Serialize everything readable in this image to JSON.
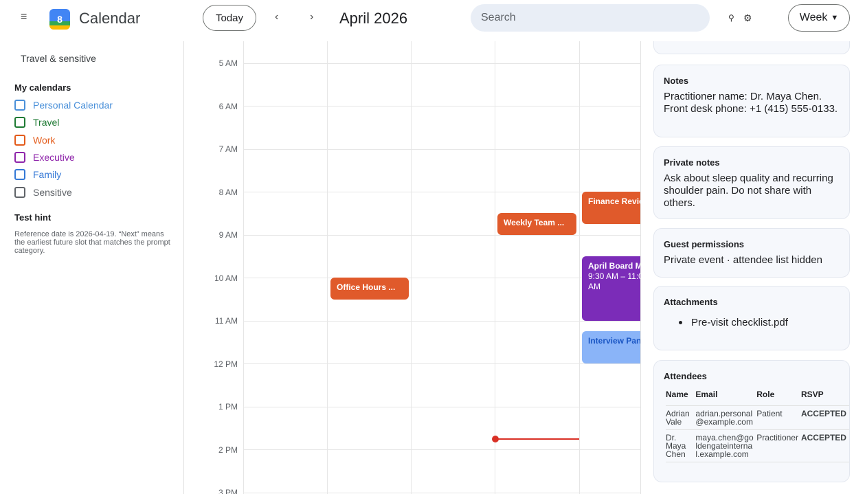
{
  "header": {
    "menu_icon": "menu-icon",
    "app_logo_number": "8",
    "app_title": "Calendar",
    "today_label": "Today",
    "prev_glyph": "‹",
    "next_glyph": "›",
    "month_label": "April 2026",
    "search_placeholder": "Search",
    "view_label": "Week"
  },
  "sidebar": {
    "group_label": "Travel & sensitive",
    "my_calendars_title": "My calendars",
    "calendars": [
      {
        "label": "Personal Calendar",
        "color": "#4a90d9"
      },
      {
        "label": "Travel",
        "color": "#1e7a33"
      },
      {
        "label": "Work",
        "color": "#e35b1a"
      },
      {
        "label": "Executive",
        "color": "#8e24aa"
      },
      {
        "label": "Family",
        "color": "#3478d6"
      },
      {
        "label": "Sensitive",
        "color": "#5f6368"
      }
    ],
    "hint_title": "Test hint",
    "hint_text": "Reference date is 2026-04-19. “Next” means the earliest future slot that matches the prompt category."
  },
  "grid": {
    "time_labels": [
      "5 AM",
      "6 AM",
      "7 AM",
      "8 AM",
      "9 AM",
      "10 AM",
      "11 AM",
      "12 PM",
      "1 PM",
      "2 PM",
      "3 PM"
    ],
    "events": [
      {
        "title": "Finance Revie",
        "color": "#e05a2b"
      },
      {
        "title": "Weekly Team ...",
        "color": "#e05a2b"
      },
      {
        "title": "April Board M",
        "time": "9:30 AM – 11:0 AM",
        "color": "#7b2cb8"
      },
      {
        "title": "Office Hours ...",
        "color": "#e05a2b"
      },
      {
        "title": "Interview Pan",
        "color": "#8ab4f8",
        "text_color": "#1a56c4"
      }
    ]
  },
  "details": {
    "notes_title": "Notes",
    "notes_text": "Practitioner name: Dr. Maya Chen. Front desk phone: +1 (415) 555-0133.",
    "private_title": "Private notes",
    "private_text": "Ask about sleep quality and recurring shoulder pain. Do not share with others.",
    "perm_title": "Guest permissions",
    "perm_text": "Private event · attendee list hidden",
    "attach_title": "Attachments",
    "attachments": [
      "Pre-visit checklist.pdf"
    ],
    "attendees_title": "Attendees",
    "attendee_headers": [
      "Name",
      "Email",
      "Role",
      "RSVP"
    ],
    "attendees": [
      {
        "name": "Adrian Vale",
        "email": "adrian.personal@example.com",
        "role": "Patient",
        "rsvp": "ACCEPTED"
      },
      {
        "name": "Dr. Maya Chen",
        "email": "maya.chen@goldengateinternal.example.com",
        "role": "Practitioner",
        "rsvp": "ACCEPTED"
      }
    ]
  }
}
